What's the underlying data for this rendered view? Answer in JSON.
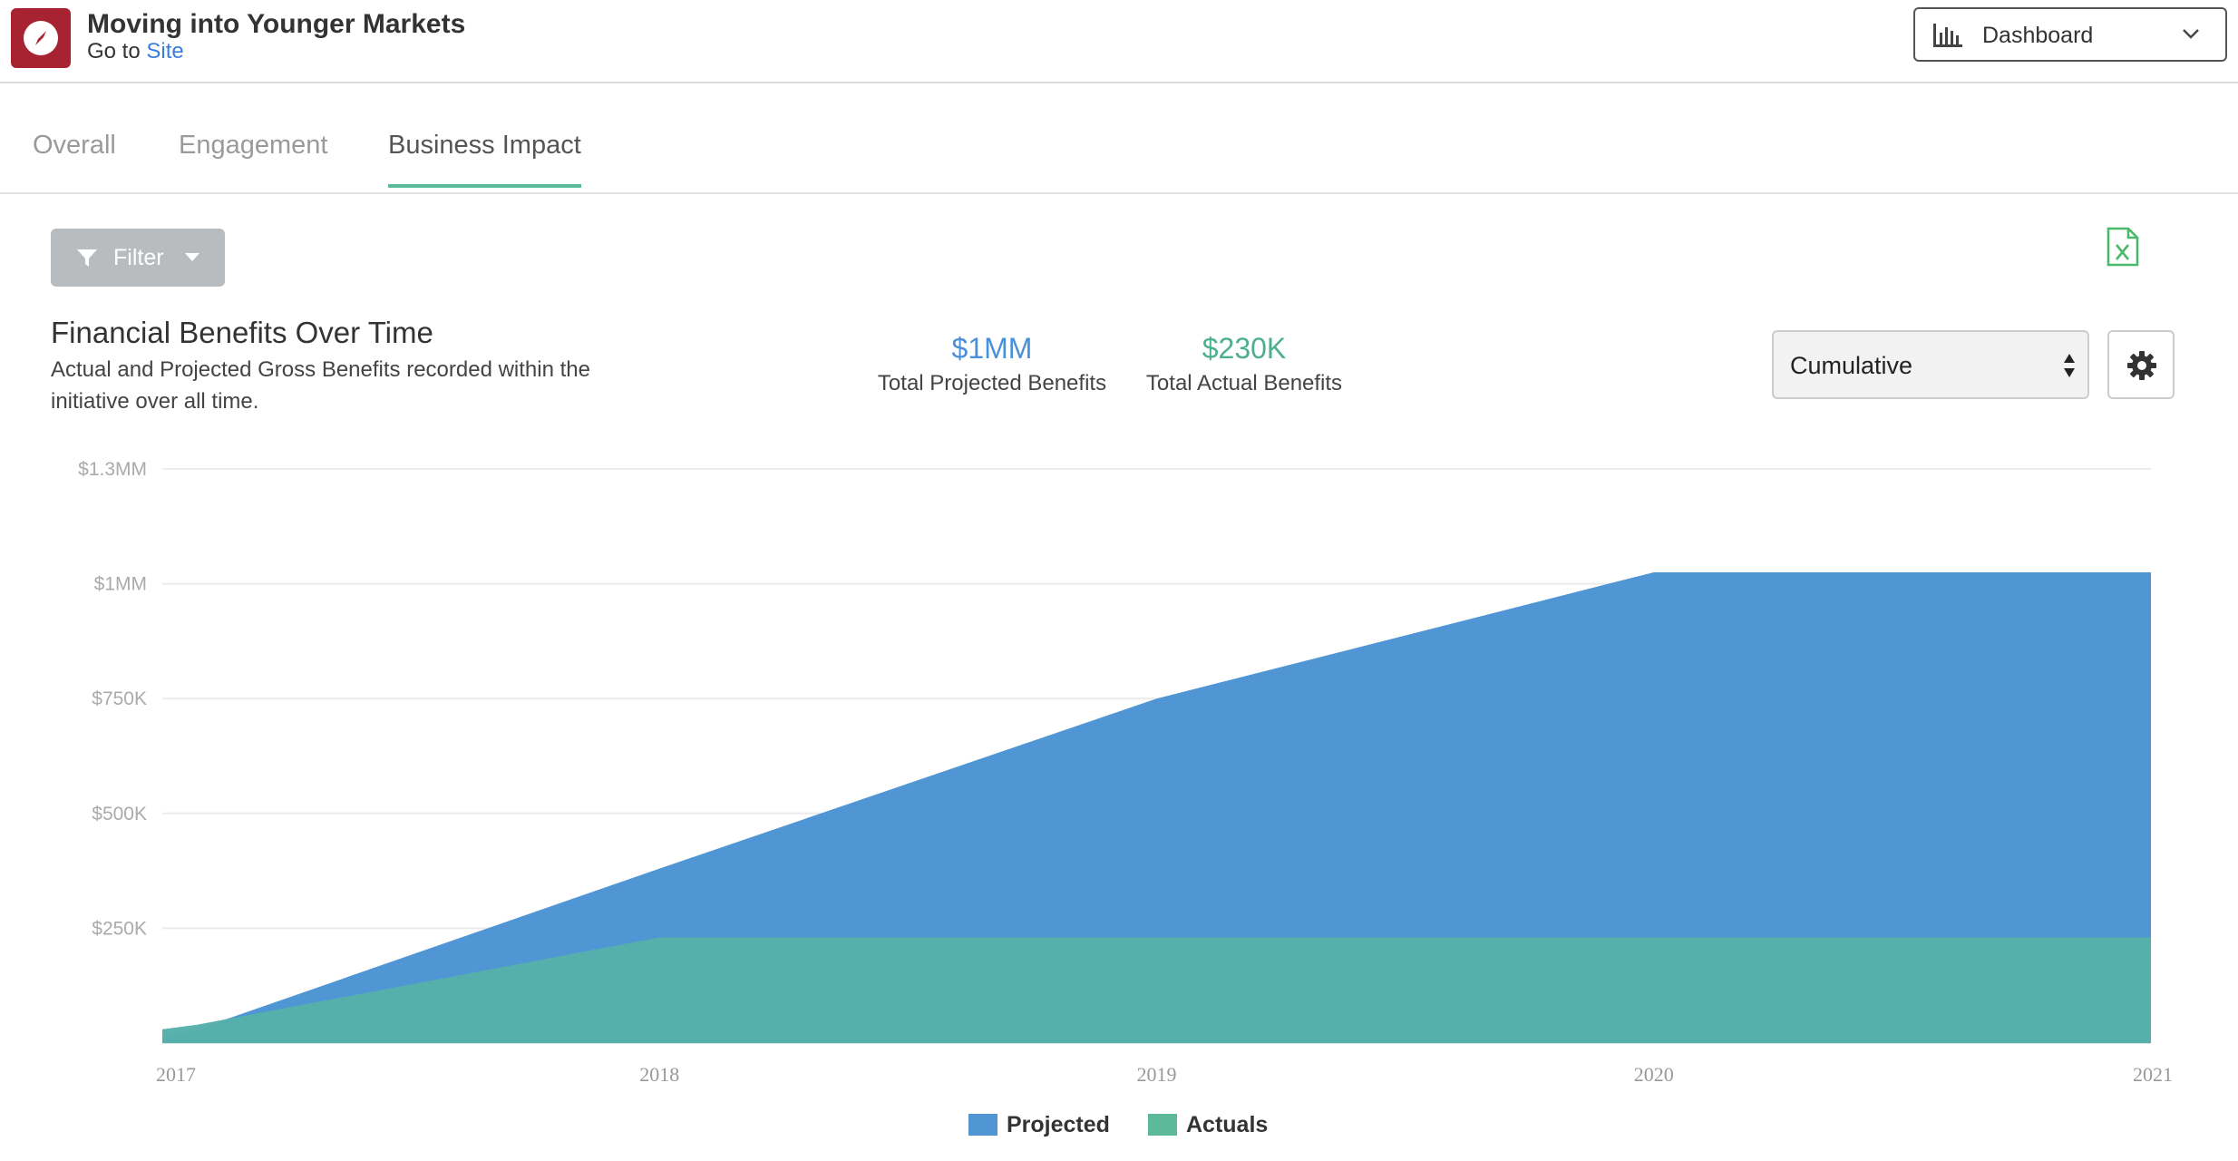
{
  "header": {
    "title": "Moving into Younger Markets",
    "goto_prefix": "Go to",
    "goto_link": "Site",
    "view_select": "Dashboard"
  },
  "tabs": [
    {
      "label": "Overall",
      "active": false
    },
    {
      "label": "Engagement",
      "active": false
    },
    {
      "label": "Business Impact",
      "active": true
    }
  ],
  "toolbar": {
    "filter_label": "Filter",
    "export_icon": "excel-export-icon"
  },
  "panel": {
    "title": "Financial Benefits Over Time",
    "subtitle": "Actual and Projected Gross Benefits recorded within the initiative over all time.",
    "kpis": [
      {
        "value": "$1MM",
        "label": "Total Projected Benefits",
        "color": "#4a90d9"
      },
      {
        "value": "$230K",
        "label": "Total Actual Benefits",
        "color": "#4cb08f"
      }
    ],
    "mode_select": "Cumulative"
  },
  "colors": {
    "projected": "#5096d4",
    "actuals": "#56b0a9",
    "accent": "#5cb99a",
    "logo": "#a82332"
  },
  "chart_data": {
    "type": "area",
    "x": [
      2017,
      2017.07,
      2018,
      2019,
      2020,
      2021
    ],
    "x_tick_labels": [
      "2017",
      "2018",
      "2019",
      "2020",
      "2021"
    ],
    "y_tick_labels": [
      "$1.3MM",
      "$1MM",
      "$750K",
      "$500K",
      "$250K"
    ],
    "ylim": [
      0,
      1250000
    ],
    "series": [
      {
        "name": "Projected",
        "values": [
          10000,
          30000,
          380000,
          750000,
          1025000,
          1025000
        ]
      },
      {
        "name": "Actuals",
        "values": [
          30000,
          40000,
          230000,
          230000,
          230000,
          230000
        ]
      }
    ],
    "legend": [
      {
        "label": "Projected",
        "color": "#5096d4"
      },
      {
        "label": "Actuals",
        "color": "#5cb99a"
      }
    ],
    "legend_position": "bottom-center",
    "grid": true
  }
}
